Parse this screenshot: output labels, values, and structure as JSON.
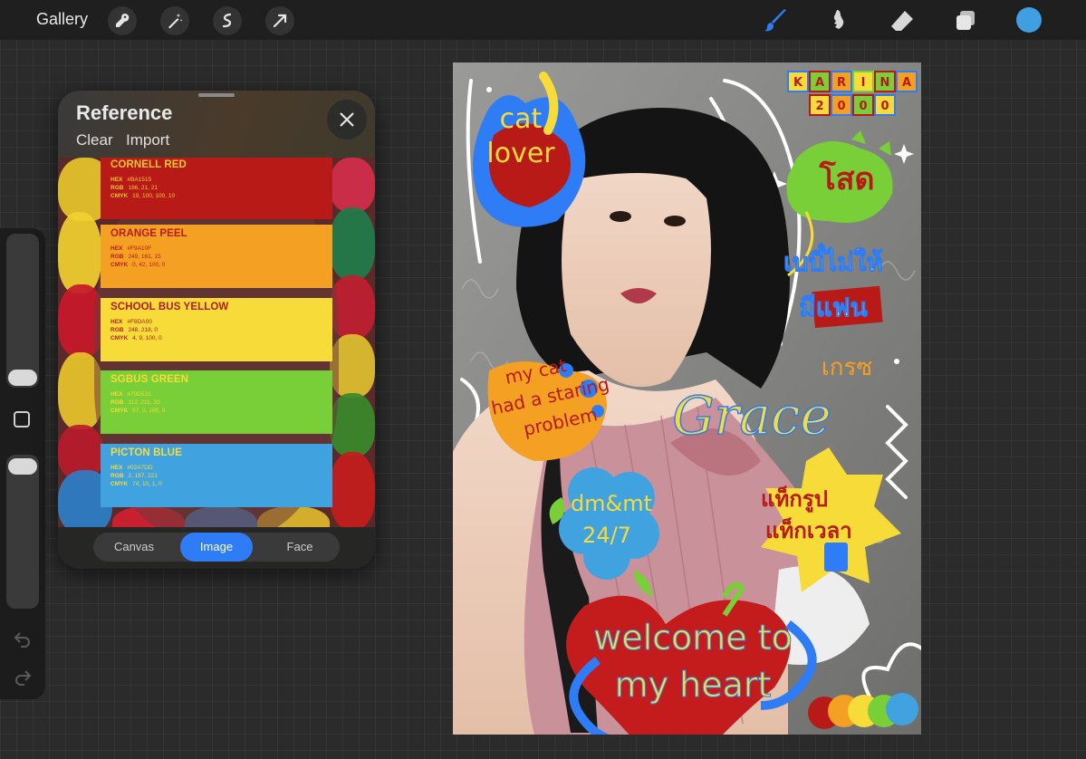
{
  "toolbar": {
    "gallery_label": "Gallery",
    "left_tools": [
      "wrench-icon",
      "magic-wand-icon",
      "selection-icon",
      "transform-arrow-icon"
    ],
    "right_tools": [
      "brush-icon",
      "smudge-icon",
      "eraser-icon",
      "layers-icon"
    ],
    "active_tool": "brush-icon",
    "accent": "#2f7df6",
    "current_color": "#3f9fe0"
  },
  "reference": {
    "title": "Reference",
    "clear_label": "Clear",
    "import_label": "Import",
    "swatches": [
      {
        "name": "CORNELL RED",
        "hex": "#BA1515",
        "rgb": "186, 21, 21",
        "cmyk": "19, 100, 100, 10",
        "bg": "#b81b17",
        "fg": "#f2c832"
      },
      {
        "name": "ORANGE PEEL",
        "hex": "#F9A10F",
        "rgb": "249, 161, 15",
        "cmyk": "0, 42, 100, 0",
        "bg": "#f4a023",
        "fg": "#b81b17"
      },
      {
        "name": "SCHOOL BUS YELLOW",
        "hex": "#F8DA00",
        "rgb": "248, 218, 0",
        "cmyk": "4, 9, 100, 0",
        "bg": "#f7db38",
        "fg": "#b81b17"
      },
      {
        "name": "SGBUS GREEN",
        "hex": "#70D521",
        "rgb": "112, 211, 33",
        "cmyk": "57, 0, 100, 0",
        "bg": "#78cf37",
        "fg": "#f7db38"
      },
      {
        "name": "PICTON BLUE",
        "hex": "#02A7DD",
        "rgb": "2, 167, 221",
        "cmyk": "74, 10, 1, 0",
        "bg": "#41a2e0",
        "fg": "#f7db38"
      }
    ],
    "labels": {
      "hex": "HEX",
      "rgb": "RGB",
      "cmyk": "CMYK"
    },
    "tabs": [
      "Canvas",
      "Image",
      "Face"
    ],
    "active_tab": "Image"
  },
  "artwork": {
    "stickers": {
      "name_blocks": [
        "K",
        "A",
        "R",
        "I",
        "N",
        "A"
      ],
      "year_blocks": [
        "2",
        "0",
        "0",
        "0"
      ],
      "cat_lover": [
        "cat",
        "lover"
      ],
      "sod": "โสด",
      "baby": [
        "เบบี๋ไม่ให้",
        "มีแฟน"
      ],
      "kreng": "เกรซ",
      "staring": [
        "my cat",
        "had a staring",
        "problem"
      ],
      "grace": "Grace",
      "dmmt": [
        "dm&mt",
        "24/7"
      ],
      "check": [
        "แท็กรูป",
        "แท็กเวลา"
      ],
      "welcome": [
        "welcome to",
        "my heart"
      ]
    }
  }
}
